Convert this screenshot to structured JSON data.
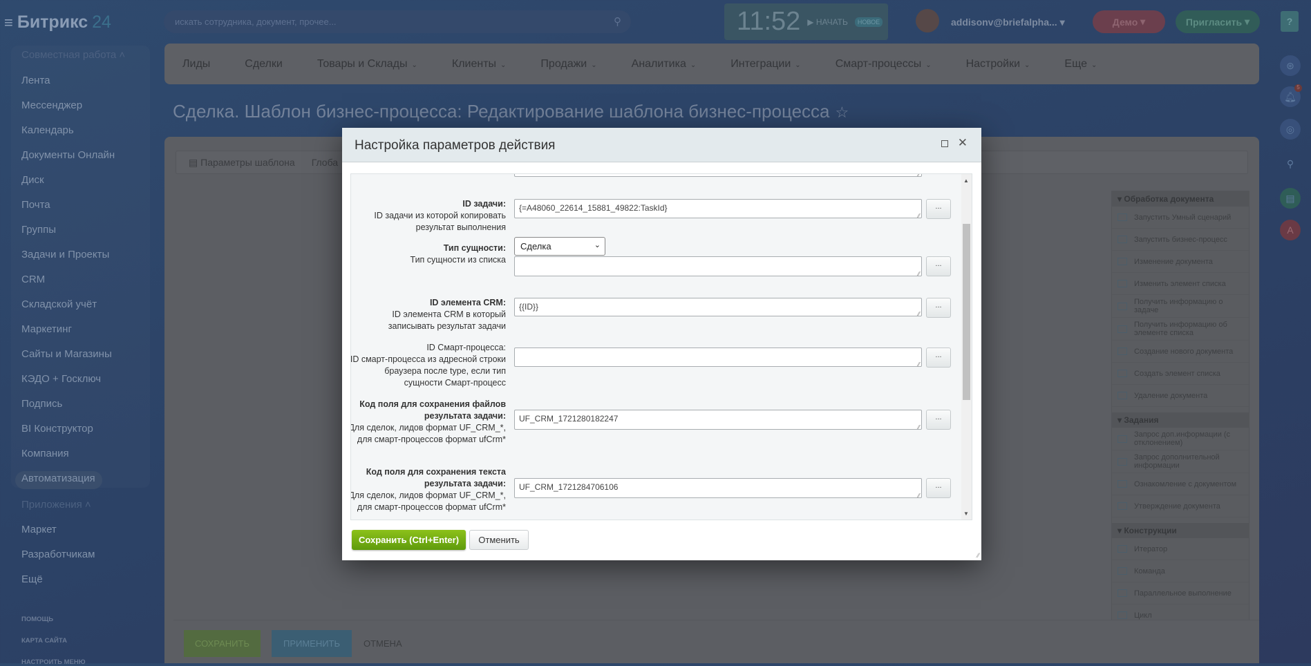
{
  "header": {
    "logo_brand": "Битрикс",
    "logo_num": "24",
    "search_placeholder": "искать сотрудника, документ, прочее...",
    "clock": "11:52",
    "start_label": "НАЧАТЬ",
    "start_badge": "НОВОЕ",
    "user_email": "addisonv@briefalpha...",
    "demo_label": "Демо",
    "invite_label": "Пригласить",
    "help_label": "?",
    "notifications_count": "5",
    "user_initial": "A"
  },
  "sidebar": {
    "section1": "Совместная работа",
    "items": [
      "Лента",
      "Мессенджер",
      "Календарь",
      "Документы Онлайн",
      "Диск",
      "Почта",
      "Группы",
      "Задачи и Проекты",
      "CRM",
      "Складской учёт",
      "Маркетинг",
      "Сайты и Магазины",
      "КЭДО + Госключ",
      "Подпись",
      "BI Конструктор",
      "Компания",
      "Автоматизация"
    ],
    "section2": "Приложения",
    "items2": [
      "Маркет",
      "Разработчикам",
      "Ещё"
    ],
    "footer": [
      "ПОМОЩЬ",
      "КАРТА САЙТА",
      "НАСТРОИТЬ МЕНЮ"
    ]
  },
  "nav": [
    "Лиды",
    "Сделки",
    "Товары и Склады",
    "Клиенты",
    "Продажи",
    "Аналитика",
    "Интеграции",
    "Смарт-процессы",
    "Настройки",
    "Еще"
  ],
  "page_title": "Сделка. Шаблон бизнес-процесса: Редактирование шаблона бизнес-процесса",
  "tabs": [
    "Параметры шаблона",
    "Глоба"
  ],
  "palette": [
    {
      "title": "Обработка документа",
      "items": [
        "Запустить Умный сценарий",
        "Запустить бизнес-процесс",
        "Изменение документа",
        "Изменить элемент списка",
        "Получить информацию о задаче",
        "Получить информацию об элементе списка",
        "Создание нового документа",
        "Создать элемент списка",
        "Удаление документа"
      ]
    },
    {
      "title": "Задания",
      "items": [
        "Запрос доп.информации (с отклонением)",
        "Запрос дополнительной информации",
        "Ознакомление с документом",
        "Утверждение документа"
      ]
    },
    {
      "title": "Конструкции",
      "items": [
        "Итератор",
        "Команда",
        "Параллельное выполнение",
        "Цикл"
      ]
    }
  ],
  "bottom": {
    "save": "СОХРАНИТЬ",
    "apply": "ПРИМЕНИТЬ",
    "cancel": "ОТМЕНА"
  },
  "modal": {
    "title": "Настройка параметров действия",
    "fields": [
      {
        "label": "ID задачи:",
        "desc": "ID задачи из которой копировать результат выполнения",
        "value": "{=A48060_22614_15881_49822:TaskId}"
      },
      {
        "label": "Тип сущности:",
        "desc": "Тип сущности из списка",
        "select": "Сделка",
        "value": ""
      },
      {
        "label": "ID элемента CRM:",
        "desc": "ID элемента CRM в который записывать результат задачи",
        "value": "{{ID}}"
      },
      {
        "label": "ID Смарт-процесса:",
        "desc": "ID смарт-процесса из адресной строки браузера после type, если тип сущности Смарт-процесс",
        "value": ""
      },
      {
        "label": "Код поля для сохранения файлов результата задачи:",
        "desc": "Для сделок, лидов формат UF_CRM_*, для смарт-процессов формат ufCrm*",
        "value": "UF_CRM_1721280182247"
      },
      {
        "label": "Код поля для сохранения текста результата задачи:",
        "desc": "Для сделок, лидов формат UF_CRM_*, для смарт-процессов формат ufCrm*",
        "value": "UF_CRM_1721284706106"
      }
    ],
    "dots_label": "...",
    "save": "Сохранить (Ctrl+Enter)",
    "cancel": "Отменить"
  }
}
